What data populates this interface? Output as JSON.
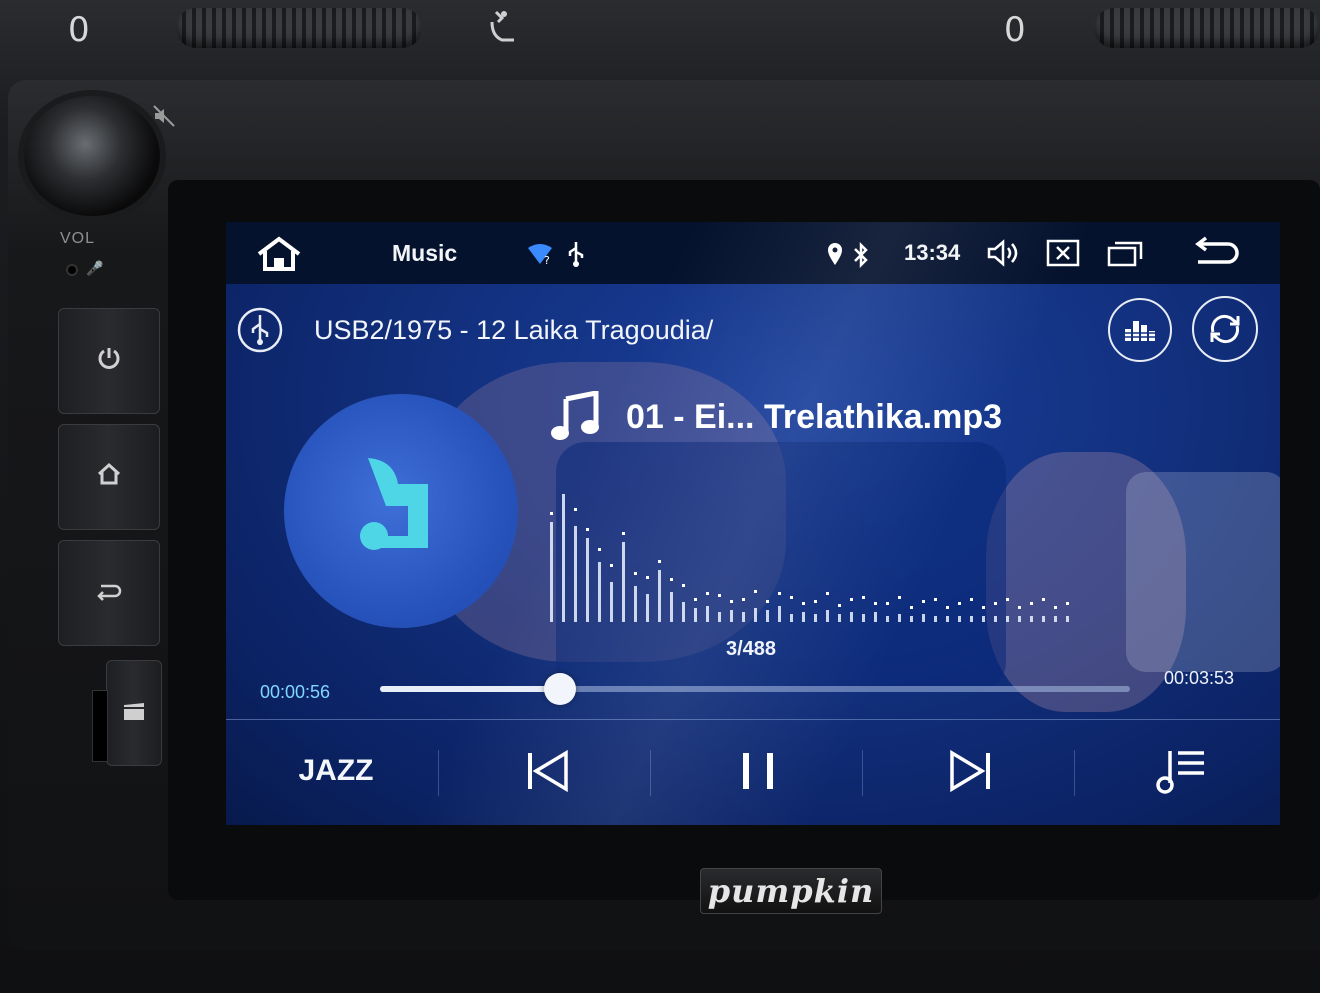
{
  "hardware": {
    "left_vent_level": "0",
    "right_vent_level": "0",
    "vol_label": "VOL",
    "brand": "pumpkin"
  },
  "statusbar": {
    "app_title": "Music",
    "time": "13:34"
  },
  "player": {
    "folder_path": "USB2/1975 - 12 Laika Tragoudia/",
    "track_title": "01 - Ei... Trelathika.mp3",
    "track_counter": "3/488",
    "elapsed": "00:00:56",
    "duration": "00:03:53",
    "progress_fraction": 0.24,
    "eq_preset": "JAZZ",
    "state": "playing"
  },
  "colors": {
    "screen_bg": "#12307e",
    "statusbar_bg": "#05122e",
    "accent_time": "#7fd7ff",
    "album_note": "#4fd6e6"
  },
  "icons": {
    "status": [
      "home-icon",
      "wifi-unknown-icon",
      "usb-icon",
      "location-icon",
      "bluetooth-icon",
      "volume-icon",
      "close-window-icon",
      "recent-apps-icon",
      "back-icon"
    ],
    "controls": [
      "previous-icon",
      "pause-icon",
      "next-icon",
      "playlist-icon"
    ],
    "top_right": [
      "equalizer-icon",
      "repeat-icon"
    ]
  }
}
